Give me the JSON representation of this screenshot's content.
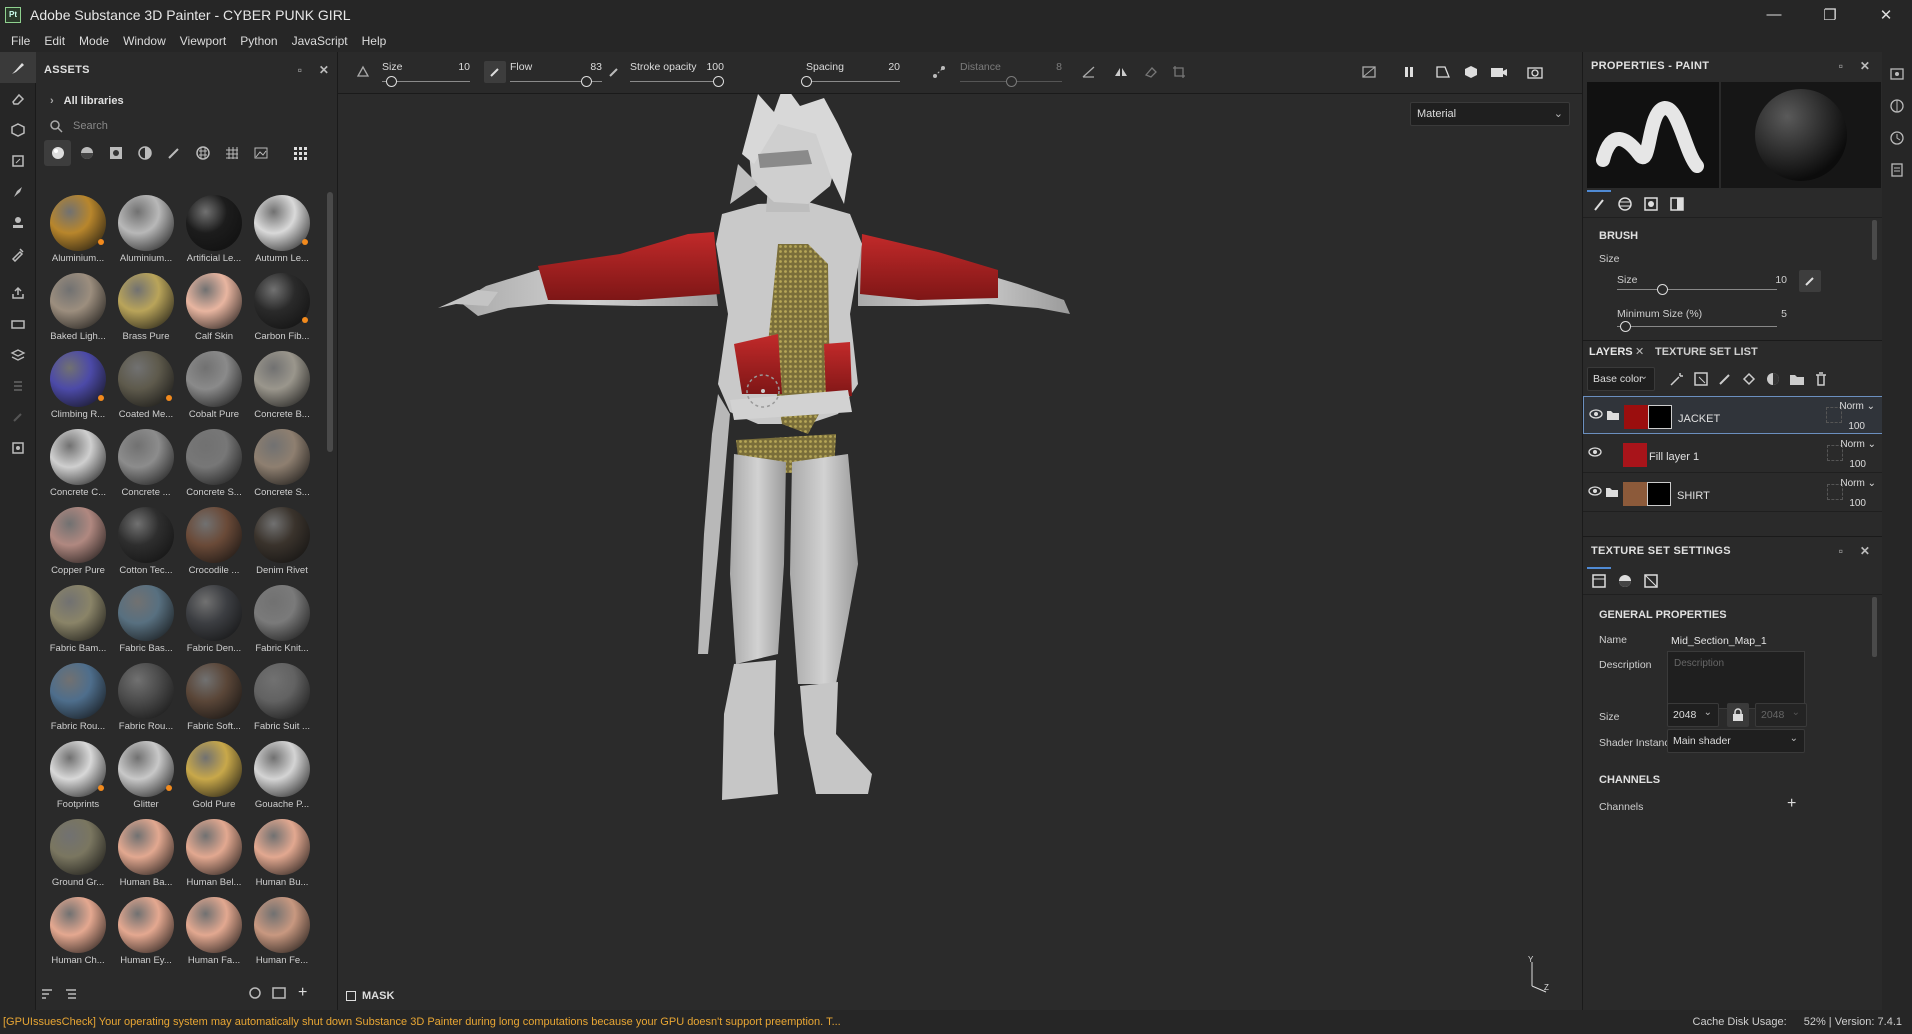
{
  "window": {
    "title": "Adobe Substance 3D Painter - CYBER PUNK GIRL",
    "logo_text": "Pt",
    "minimize": "—",
    "maximize": "❐",
    "close": "✕"
  },
  "menu": [
    "File",
    "Edit",
    "Mode",
    "Window",
    "Viewport",
    "Python",
    "JavaScript",
    "Help"
  ],
  "assets": {
    "title": "ASSETS",
    "library": "All libraries",
    "search_placeholder": "Search",
    "materials": [
      {
        "label": "Aluminium...",
        "color": "#b8862c",
        "badge": true
      },
      {
        "label": "Aluminium...",
        "color": "#b8b8b8",
        "badge": false
      },
      {
        "label": "Artificial Le...",
        "color": "#1c1c1c",
        "badge": false
      },
      {
        "label": "Autumn Le...",
        "color": "#d9d9d9",
        "badge": true
      },
      {
        "label": "Baked Ligh...",
        "color": "#9c8e7e",
        "badge": false
      },
      {
        "label": "Brass Pure",
        "color": "#b9a45a",
        "badge": false
      },
      {
        "label": "Calf Skin",
        "color": "#e8b5a0",
        "badge": false
      },
      {
        "label": "Carbon Fib...",
        "color": "#2a2a2a",
        "badge": true
      },
      {
        "label": "Climbing R...",
        "color": "#4c4aa8",
        "badge": true
      },
      {
        "label": "Coated Me...",
        "color": "#5e5a4c",
        "badge": true
      },
      {
        "label": "Cobalt Pure",
        "color": "#8a8a8a",
        "badge": false
      },
      {
        "label": "Concrete B...",
        "color": "#9a968c",
        "badge": false
      },
      {
        "label": "Concrete C...",
        "color": "#cfcfcf",
        "badge": false
      },
      {
        "label": "Concrete ...",
        "color": "#8c8c8c",
        "badge": false
      },
      {
        "label": "Concrete S...",
        "color": "#777777",
        "badge": false
      },
      {
        "label": "Concrete S...",
        "color": "#8e7f70",
        "badge": false
      },
      {
        "label": "Copper Pure",
        "color": "#b08880",
        "badge": false
      },
      {
        "label": "Cotton Tec...",
        "color": "#2e2e2e",
        "badge": false
      },
      {
        "label": "Crocodile ...",
        "color": "#6a4a38",
        "badge": false
      },
      {
        "label": "Denim Rivet",
        "color": "#3a332c",
        "badge": false
      },
      {
        "label": "Fabric Bam...",
        "color": "#8a8468",
        "badge": false
      },
      {
        "label": "Fabric Bas...",
        "color": "#587080",
        "badge": false
      },
      {
        "label": "Fabric Den...",
        "color": "#3c3e42",
        "badge": false
      },
      {
        "label": "Fabric Knit...",
        "color": "#7a7a7a",
        "badge": false
      },
      {
        "label": "Fabric Rou...",
        "color": "#4e6e8c",
        "badge": false
      },
      {
        "label": "Fabric Rou...",
        "color": "#4c4c4c",
        "badge": false
      },
      {
        "label": "Fabric Soft...",
        "color": "#5a4638",
        "badge": false
      },
      {
        "label": "Fabric Suit ...",
        "color": "#626262",
        "badge": false
      },
      {
        "label": "Footprints",
        "color": "#d8d8d8",
        "badge": true
      },
      {
        "label": "Glitter",
        "color": "#c8c8c8",
        "badge": true
      },
      {
        "label": "Gold Pure",
        "color": "#c8a84a",
        "badge": false
      },
      {
        "label": "Gouache P...",
        "color": "#d4d4d4",
        "badge": false
      },
      {
        "label": "Ground Gr...",
        "color": "#7a7660",
        "badge": false
      },
      {
        "label": "Human Ba...",
        "color": "#e2a890",
        "badge": false
      },
      {
        "label": "Human Bel...",
        "color": "#e2a890",
        "badge": false
      },
      {
        "label": "Human Bu...",
        "color": "#e2a890",
        "badge": false
      },
      {
        "label": "Human Ch...",
        "color": "#e4a890",
        "badge": false
      },
      {
        "label": "Human Ey...",
        "color": "#e4a890",
        "badge": false
      },
      {
        "label": "Human Fa...",
        "color": "#e2a890",
        "badge": false
      },
      {
        "label": "Human Fe...",
        "color": "#c89880",
        "badge": false
      }
    ]
  },
  "toolbar": {
    "size_label": "Size",
    "size_value": "10",
    "size_level": 0.1,
    "flow_label": "Flow",
    "flow_value": "83",
    "flow_level": 0.83,
    "stroke_label": "Stroke opacity",
    "stroke_value": "100",
    "stroke_level": 1.0,
    "spacing_label": "Spacing",
    "spacing_value": "20",
    "spacing_level": 0.0,
    "distance_label": "Distance",
    "distance_value": "8",
    "distance_level": 0.5
  },
  "viewport": {
    "material_mode": "Material",
    "mask_label": "MASK"
  },
  "properties": {
    "title": "PROPERTIES - PAINT",
    "brush_section": "BRUSH",
    "size_group": "Size",
    "size_label": "Size",
    "size_value": "10",
    "size_level": 0.28,
    "min_size_label": "Minimum Size (%)",
    "min_size_value": "5",
    "min_size_level": 0.05
  },
  "layers": {
    "tab_layers": "LAYERS",
    "tab_texture": "TEXTURE SET LIST",
    "channel": "Base color",
    "items": [
      {
        "name": "JACKET",
        "blend": "Norm",
        "opacity": "100"
      },
      {
        "name": "Fill layer 1",
        "blend": "Norm",
        "opacity": "100"
      },
      {
        "name": "SHIRT",
        "blend": "Norm",
        "opacity": "100"
      }
    ]
  },
  "texture_set": {
    "title": "TEXTURE SET SETTINGS",
    "general": "GENERAL PROPERTIES",
    "name_label": "Name",
    "name_value": "Mid_Section_Map_1",
    "desc_label": "Description",
    "desc_placeholder": "Description",
    "size_label": "Size",
    "size_value": "2048",
    "size_value2": "2048",
    "shader_label": "Shader Instance",
    "shader_value": "Main shader",
    "channels_section": "CHANNELS",
    "channels_label": "Channels"
  },
  "status": {
    "warning": "[GPUIssuesCheck] Your operating system may automatically shut down Substance 3D Painter during long computations because your GPU doesn't support preemption. T...",
    "cache_label": "Cache Disk Usage:",
    "cache_value": "52% | Version: 7.4.1"
  },
  "axis_labels": {
    "y": "Y",
    "z": "Z"
  }
}
